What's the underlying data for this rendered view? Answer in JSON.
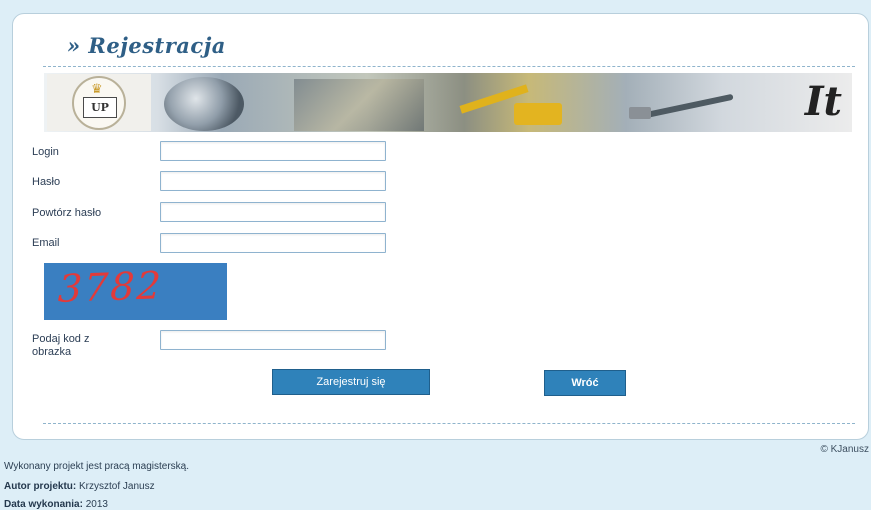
{
  "page": {
    "title": "» Rejestracja"
  },
  "banner": {
    "seal_text": "UP",
    "logo_text": "It"
  },
  "form": {
    "login_label": "Login",
    "login_value": "",
    "password_label": "Hasło",
    "password_value": "",
    "repeat_password_label": "Powtórz hasło",
    "repeat_password_value": "",
    "email_label": "Email",
    "email_value": "",
    "captcha_code": "3782",
    "captcha_label": "Podaj kod z obrazka",
    "captcha_value": ""
  },
  "buttons": {
    "register": "Zarejestruj się",
    "back": "Wróć"
  },
  "footer": {
    "copyright": "© KJanusz",
    "line1": "Wykonany projekt jest pracą magisterską.",
    "author_label": "Autor projektu:",
    "author_value": "Krzysztof Janusz",
    "date_label": "Data wykonania:",
    "date_value": "2013"
  },
  "colors": {
    "page_background": "#ddeef7",
    "title": "#2f5f86",
    "button": "#2f82ba",
    "captcha_background": "#3a7fc1",
    "captcha_text": "#e23a3a"
  },
  "icons": {
    "seal": "university-seal-icon",
    "crown": "crown-icon"
  }
}
